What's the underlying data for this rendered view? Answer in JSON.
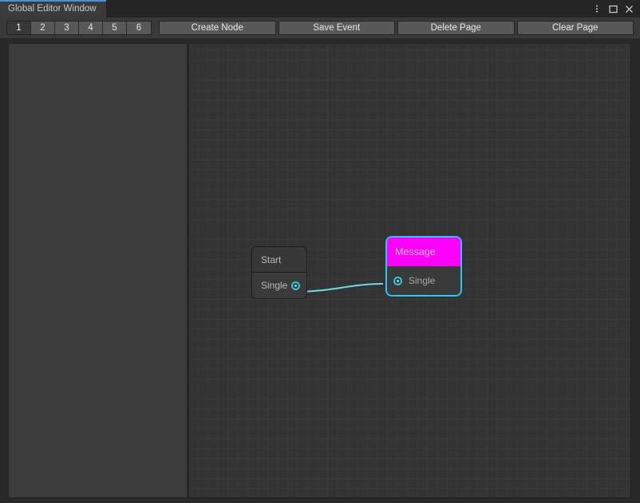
{
  "window": {
    "tab_title": "Global Editor Window",
    "accent_color": "#4a90d9",
    "controls": [
      {
        "name": "menu-kebab-icon",
        "label": "⋮"
      },
      {
        "name": "maximize-icon",
        "label": "□"
      },
      {
        "name": "close-icon",
        "label": "✕"
      }
    ]
  },
  "toolbar": {
    "page_numbers": [
      "1",
      "2",
      "3",
      "4",
      "5",
      "6"
    ],
    "active_page": "1",
    "buttons": [
      {
        "label": "Create Node"
      },
      {
        "label": "Save Event"
      },
      {
        "label": "Delete Page"
      },
      {
        "label": "Clear Page"
      }
    ]
  },
  "graph": {
    "background_color": "#333333",
    "grid_minor_color": "#3a3a3a",
    "grid_major_color": "#232323",
    "grid_minor_size": 12.5,
    "grid_major_size": 100,
    "wire_color": "#6fdce3",
    "nodes": [
      {
        "id": "start",
        "title": "Start",
        "selected": false,
        "header_color": "#373737",
        "ports": [
          {
            "label": "Single",
            "direction": "output",
            "color": "#2ec8d8"
          }
        ]
      },
      {
        "id": "message",
        "title": "Message",
        "selected": true,
        "header_color": "#ff00ff",
        "selection_color": "#29c5f6",
        "ports": [
          {
            "label": "Single",
            "direction": "input",
            "color": "#2ec8d8"
          }
        ]
      }
    ],
    "connections": [
      {
        "from": "start.Single",
        "to": "message.Single"
      }
    ]
  }
}
